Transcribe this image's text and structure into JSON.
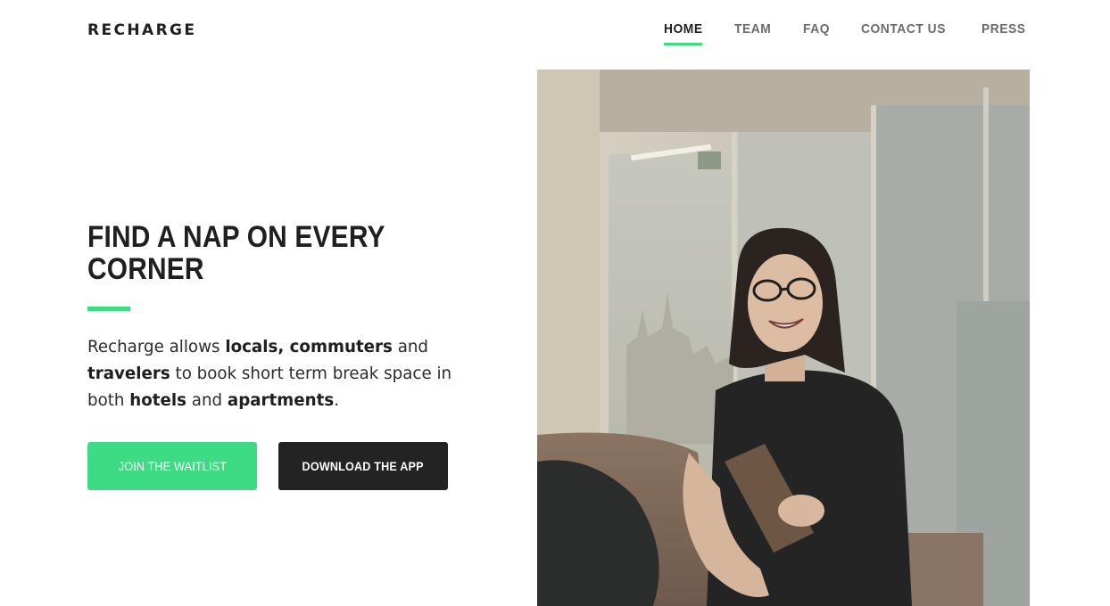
{
  "header": {
    "logo": "RECHARGE",
    "nav": [
      {
        "label": "HOME",
        "active": true
      },
      {
        "label": "TEAM",
        "active": false
      },
      {
        "label": "FAQ",
        "active": false
      },
      {
        "label": "CONTACT US",
        "active": false
      },
      {
        "label": "PRESS",
        "active": false
      }
    ]
  },
  "hero": {
    "title": "FIND A NAP ON EVERY CORNER",
    "description": {
      "t1": "Recharge allows ",
      "b1": "locals, commuters",
      "t2": " and ",
      "b2": "travelers",
      "t3": " to book short term break space in both ",
      "b3": "hotels",
      "t4": " and ",
      "b4": "apartments",
      "t5": "."
    },
    "buttons": {
      "waitlist": "JOIN THE WAITLIST",
      "download": "DOWNLOAD THE APP"
    }
  },
  "colors": {
    "accent": "#3ddc84",
    "dark": "#232323",
    "text": "#2b2b2b"
  }
}
